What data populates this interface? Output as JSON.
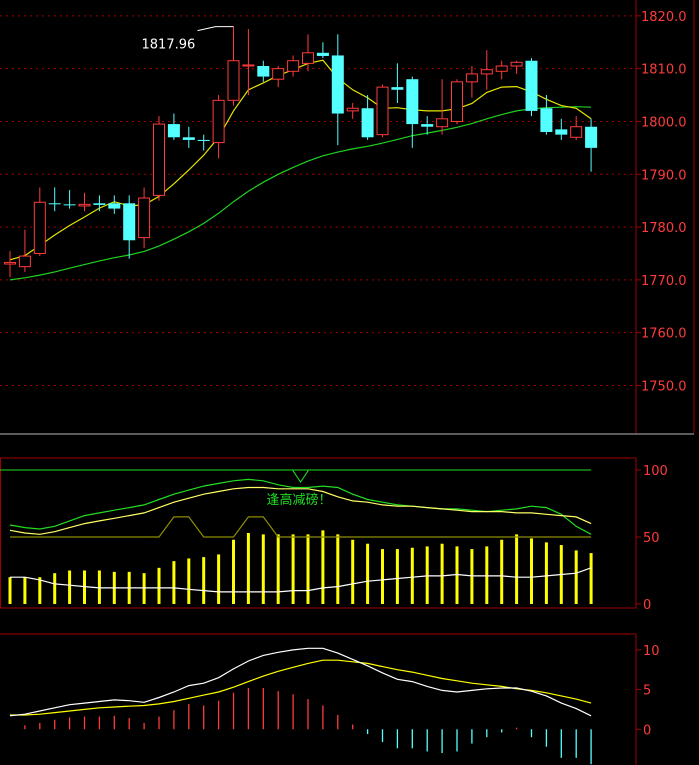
{
  "colors": {
    "background": "#000000",
    "up_candle": "#ff3b3b",
    "down_candle": "#54ffff",
    "ma_short": "#e6e600",
    "ma_long": "#1fd21f",
    "grid": "#a00000",
    "axis_text": "#ff3b3b",
    "kdj_line1": "#ffff66",
    "kdj_line2": "#22dd22",
    "kdj_hist": "#ffff00",
    "kdj_white": "#ffffff",
    "macd_dif": "#ffffff",
    "macd_dea": "#ffff00",
    "macd_pos": "#ff3b3b",
    "macd_neg": "#54ffff",
    "annotation": "#22dd22"
  },
  "chart_data": [
    {
      "type": "candlestick",
      "ylim": [
        1741,
        1823
      ],
      "yticks": [
        "1820.0",
        "1810.0",
        "1800.0",
        "1790.0",
        "1780.0",
        "1770.0",
        "1760.0",
        "1750.0"
      ],
      "high_annotation": "1817.96",
      "candles": [
        {
          "o": 1773.0,
          "h": 1775.5,
          "l": 1770.5,
          "c": 1773.3
        },
        {
          "o": 1772.5,
          "h": 1779.5,
          "l": 1771.5,
          "c": 1774.5
        },
        {
          "o": 1775.0,
          "h": 1787.5,
          "l": 1774.5,
          "c": 1784.7
        },
        {
          "o": 1784.5,
          "h": 1787.5,
          "l": 1783.0,
          "c": 1784.4
        },
        {
          "o": 1784.3,
          "h": 1787.0,
          "l": 1783.5,
          "c": 1784.2
        },
        {
          "o": 1784.0,
          "h": 1786.5,
          "l": 1783.0,
          "c": 1784.3
        },
        {
          "o": 1784.5,
          "h": 1786.0,
          "l": 1783.0,
          "c": 1784.2
        },
        {
          "o": 1784.5,
          "h": 1786.0,
          "l": 1782.5,
          "c": 1783.5
        },
        {
          "o": 1784.5,
          "h": 1786.0,
          "l": 1774.0,
          "c": 1777.5
        },
        {
          "o": 1778.0,
          "h": 1787.5,
          "l": 1776.0,
          "c": 1785.5
        },
        {
          "o": 1786.0,
          "h": 1801.0,
          "l": 1785.0,
          "c": 1799.5
        },
        {
          "o": 1799.5,
          "h": 1801.5,
          "l": 1796.5,
          "c": 1797.0
        },
        {
          "o": 1797.0,
          "h": 1799.0,
          "l": 1795.0,
          "c": 1796.5
        },
        {
          "o": 1796.5,
          "h": 1797.5,
          "l": 1794.5,
          "c": 1796.3
        },
        {
          "o": 1796.0,
          "h": 1805.0,
          "l": 1793.0,
          "c": 1804.0
        },
        {
          "o": 1804.0,
          "h": 1817.96,
          "l": 1803.0,
          "c": 1811.5
        },
        {
          "o": 1810.5,
          "h": 1817.5,
          "l": 1805.0,
          "c": 1810.7
        },
        {
          "o": 1810.5,
          "h": 1811.5,
          "l": 1807.5,
          "c": 1808.5
        },
        {
          "o": 1808.0,
          "h": 1810.5,
          "l": 1806.5,
          "c": 1810.0
        },
        {
          "o": 1809.5,
          "h": 1812.5,
          "l": 1808.5,
          "c": 1811.5
        },
        {
          "o": 1811.0,
          "h": 1816.5,
          "l": 1809.5,
          "c": 1813.0
        },
        {
          "o": 1813.0,
          "h": 1815.0,
          "l": 1812.0,
          "c": 1812.4
        },
        {
          "o": 1812.5,
          "h": 1816.5,
          "l": 1795.5,
          "c": 1801.5
        },
        {
          "o": 1802.0,
          "h": 1803.5,
          "l": 1800.5,
          "c": 1802.5
        },
        {
          "o": 1802.5,
          "h": 1805.0,
          "l": 1796.5,
          "c": 1797.0
        },
        {
          "o": 1797.5,
          "h": 1807.0,
          "l": 1797.0,
          "c": 1806.5
        },
        {
          "o": 1806.5,
          "h": 1811.0,
          "l": 1803.5,
          "c": 1806.0
        },
        {
          "o": 1808.0,
          "h": 1808.5,
          "l": 1795.0,
          "c": 1799.5
        },
        {
          "o": 1799.5,
          "h": 1801.0,
          "l": 1797.5,
          "c": 1799.0
        },
        {
          "o": 1799.0,
          "h": 1808.0,
          "l": 1797.5,
          "c": 1800.5
        },
        {
          "o": 1800.0,
          "h": 1808.0,
          "l": 1799.5,
          "c": 1807.5
        },
        {
          "o": 1807.5,
          "h": 1810.5,
          "l": 1804.5,
          "c": 1809.0
        },
        {
          "o": 1809.0,
          "h": 1813.5,
          "l": 1806.0,
          "c": 1809.8
        },
        {
          "o": 1809.5,
          "h": 1811.5,
          "l": 1808.0,
          "c": 1810.5
        },
        {
          "o": 1810.5,
          "h": 1811.5,
          "l": 1809.0,
          "c": 1811.2
        },
        {
          "o": 1811.5,
          "h": 1812.0,
          "l": 1801.0,
          "c": 1802.0
        },
        {
          "o": 1802.5,
          "h": 1805.0,
          "l": 1797.5,
          "c": 1798.0
        },
        {
          "o": 1798.5,
          "h": 1800.5,
          "l": 1796.5,
          "c": 1797.5
        },
        {
          "o": 1797.0,
          "h": 1801.0,
          "l": 1796.5,
          "c": 1799.0
        },
        {
          "o": 1799.0,
          "h": 1800.5,
          "l": 1790.5,
          "c": 1795.0
        }
      ],
      "ma_short": [
        1773.8,
        1774.6,
        1776.5,
        1778.5,
        1780.3,
        1781.9,
        1783.6,
        1784.8,
        1784.0,
        1784.2,
        1785.8,
        1788.2,
        1790.8,
        1793.6,
        1797.0,
        1802.0,
        1806.0,
        1807.3,
        1808.7,
        1809.8,
        1811.0,
        1811.6,
        1808.2,
        1806.0,
        1804.5,
        1802.5,
        1802.6,
        1802.2,
        1802.0,
        1802.0,
        1802.4,
        1803.4,
        1805.5,
        1806.5,
        1806.6,
        1805.6,
        1804.2,
        1803.0,
        1802.5,
        1800.5
      ],
      "ma_long": [
        1770.0,
        1770.4,
        1770.9,
        1771.5,
        1772.2,
        1772.9,
        1773.6,
        1774.2,
        1774.7,
        1775.4,
        1776.4,
        1777.7,
        1779.1,
        1780.7,
        1782.6,
        1784.8,
        1786.8,
        1788.5,
        1790.0,
        1791.3,
        1792.5,
        1793.5,
        1794.2,
        1794.8,
        1795.3,
        1795.9,
        1796.6,
        1797.3,
        1797.8,
        1798.3,
        1798.9,
        1799.6,
        1800.5,
        1801.3,
        1802.0,
        1802.4,
        1802.6,
        1802.7,
        1802.8,
        1802.7
      ]
    },
    {
      "type": "kdj",
      "ylim": [
        -3,
        109
      ],
      "yticks": [
        "100",
        "50",
        "0"
      ],
      "annotation": "逢高减磅！",
      "line1": [
        55,
        53,
        52,
        54,
        57,
        60,
        62,
        64,
        66,
        68,
        72,
        76,
        79,
        82,
        84,
        86,
        87,
        87,
        86,
        86,
        86,
        84,
        80,
        77,
        76,
        74,
        73,
        73,
        72,
        71,
        70,
        69,
        69,
        69,
        68,
        68,
        67,
        66,
        65,
        60
      ],
      "line2": [
        59,
        57,
        56,
        58,
        62,
        66,
        68,
        70,
        72,
        74,
        78,
        82,
        85,
        88,
        90,
        92,
        93,
        92,
        89,
        87,
        87,
        88,
        87,
        82,
        78,
        76,
        74,
        73,
        72,
        71,
        71,
        70,
        69,
        70,
        71,
        73,
        72,
        67,
        58,
        52
      ],
      "hist": [
        20,
        20,
        20,
        23,
        25,
        25,
        25,
        24,
        24,
        23,
        27,
        32,
        34,
        35,
        37,
        48,
        53,
        52,
        52,
        52,
        52,
        55,
        52,
        48,
        45,
        41,
        41,
        42,
        43,
        45,
        43,
        41,
        43,
        48,
        52,
        49,
        46,
        44,
        40,
        38
      ],
      "line_white": [
        20,
        20,
        18,
        15,
        14,
        13,
        12,
        12,
        12,
        12,
        12,
        12,
        11,
        10,
        9,
        9,
        9,
        9,
        9,
        10,
        10,
        12,
        13,
        15,
        17,
        18,
        19,
        20,
        21,
        21,
        22,
        21,
        21,
        21,
        20,
        20,
        21,
        22,
        23,
        27
      ],
      "step_top": 100,
      "step_line": [
        50,
        50,
        50,
        50,
        50,
        50,
        50,
        50,
        50,
        50,
        50,
        65,
        65,
        50,
        50,
        50,
        65,
        65,
        50,
        50,
        50,
        50,
        50,
        50,
        50,
        50,
        50,
        50,
        50,
        50,
        50,
        50,
        50,
        50,
        50,
        50,
        50,
        50,
        50,
        50
      ]
    },
    {
      "type": "macd",
      "ylim": [
        -4.5,
        12
      ],
      "yticks": [
        "10",
        "5",
        "0"
      ],
      "dif": [
        1.7,
        1.9,
        2.3,
        2.7,
        3.1,
        3.3,
        3.5,
        3.7,
        3.6,
        3.4,
        4.0,
        4.7,
        5.5,
        5.8,
        6.5,
        7.6,
        8.6,
        9.3,
        9.7,
        10.0,
        10.2,
        10.2,
        9.6,
        8.8,
        8.0,
        7.1,
        6.3,
        6.0,
        5.4,
        4.9,
        4.7,
        4.9,
        5.1,
        5.2,
        5.2,
        4.8,
        4.2,
        3.3,
        2.6,
        1.7
      ],
      "dea": [
        1.8,
        1.8,
        1.9,
        2.1,
        2.3,
        2.5,
        2.7,
        2.8,
        2.9,
        3.0,
        3.2,
        3.5,
        3.9,
        4.3,
        4.7,
        5.3,
        6.0,
        6.7,
        7.3,
        7.8,
        8.3,
        8.7,
        8.7,
        8.5,
        8.3,
        7.9,
        7.5,
        7.2,
        6.8,
        6.4,
        6.1,
        5.8,
        5.6,
        5.4,
        5.1,
        4.9,
        4.6,
        4.2,
        3.8,
        3.3
      ],
      "hist": [
        0,
        0.5,
        0.8,
        1.2,
        1.5,
        1.6,
        1.6,
        1.7,
        1.4,
        0.8,
        1.6,
        2.4,
        3.2,
        3.0,
        3.6,
        4.6,
        5.2,
        5.2,
        4.8,
        4.4,
        3.8,
        3.0,
        1.8,
        0.6,
        -0.6,
        -1.6,
        -2.4,
        -2.4,
        -2.8,
        -3.0,
        -2.8,
        -1.8,
        -1.0,
        -0.4,
        0.2,
        -1.0,
        -2.2,
        -3.6,
        -3.6,
        -4.4
      ]
    }
  ]
}
